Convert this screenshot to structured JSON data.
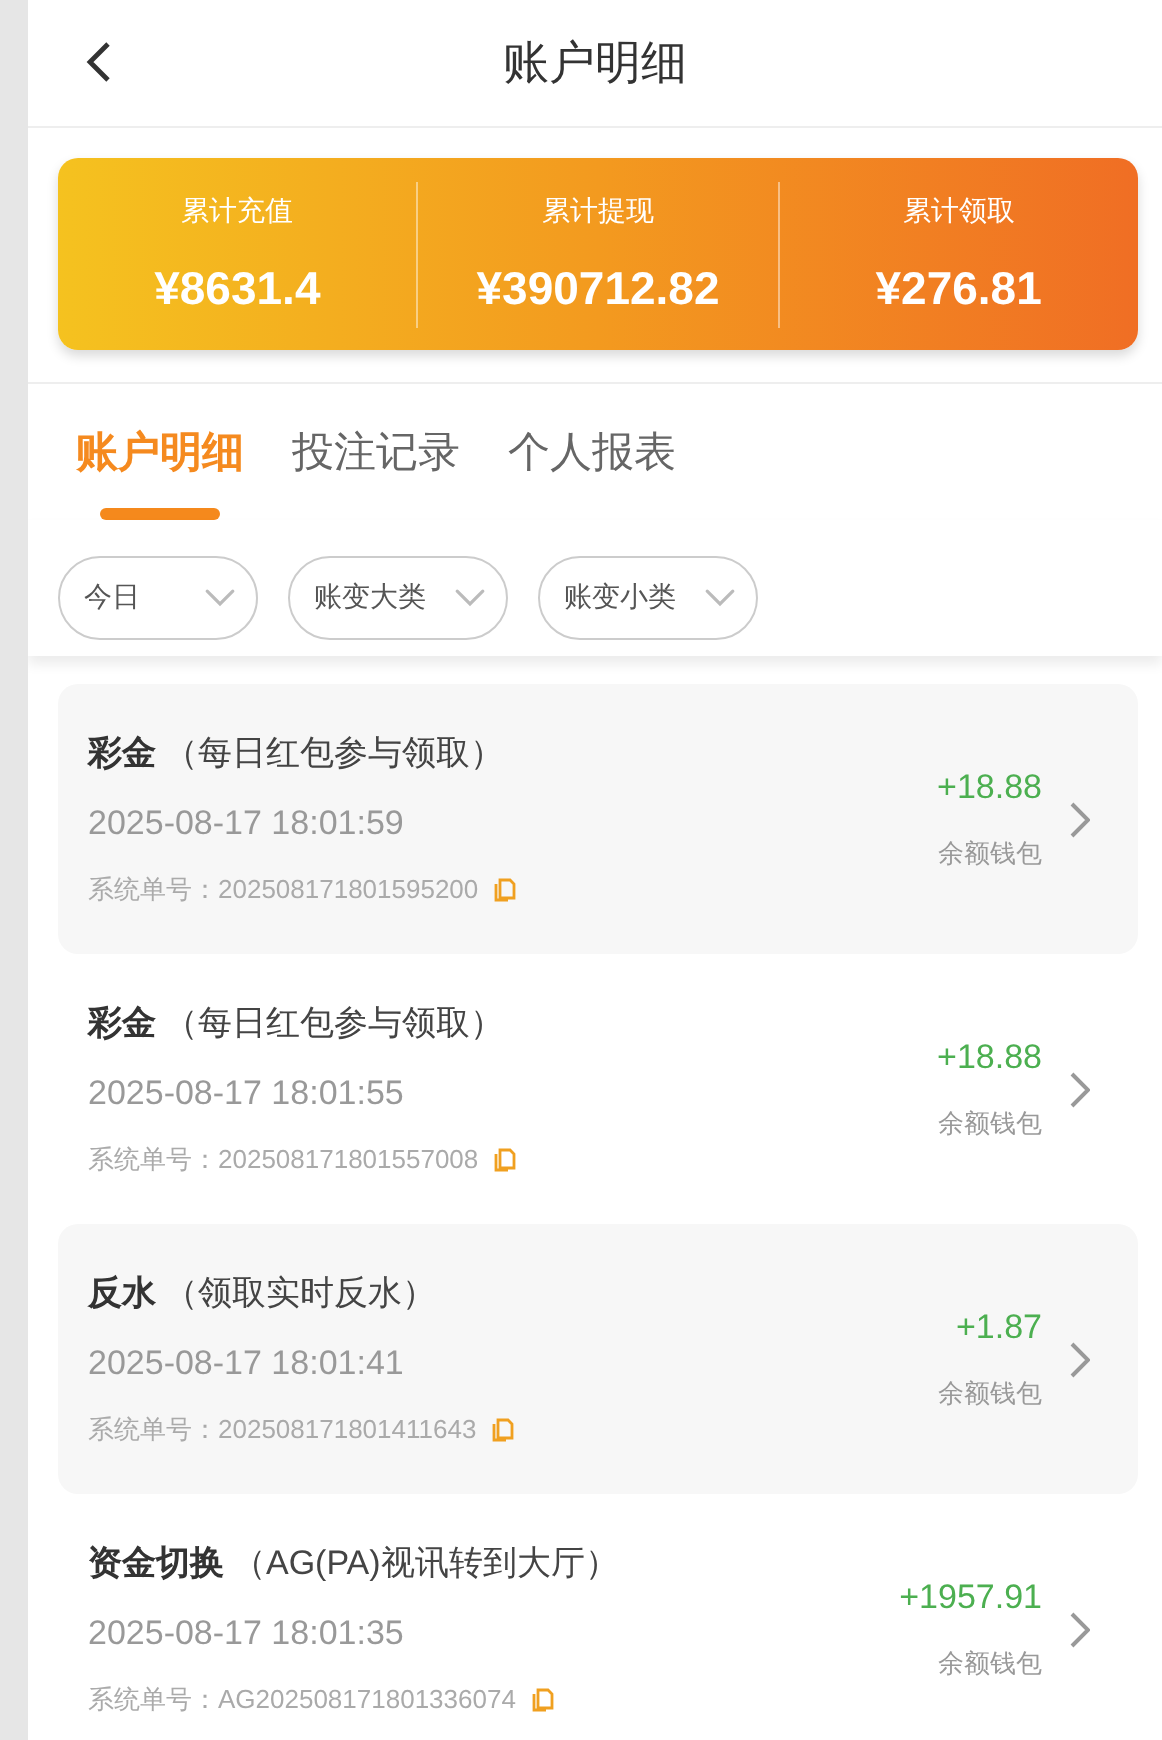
{
  "header": {
    "title": "账户明细"
  },
  "summary": [
    {
      "label": "累计充值",
      "value": "¥8631.4"
    },
    {
      "label": "累计提现",
      "value": "¥390712.82"
    },
    {
      "label": "累计领取",
      "value": "¥276.81"
    }
  ],
  "tabs": [
    {
      "label": "账户明细",
      "selected": true
    },
    {
      "label": "投注记录",
      "selected": false
    },
    {
      "label": "个人报表",
      "selected": false
    }
  ],
  "filters": [
    {
      "label": "今日"
    },
    {
      "label": "账变大类"
    },
    {
      "label": "账变小类"
    }
  ],
  "records": [
    {
      "type": "彩金",
      "note": "（每日红包参与领取）",
      "time": "2025-08-17 18:01:59",
      "order": "系统单号：202508171801595200",
      "amount": "+18.88",
      "wallet": "余额钱包"
    },
    {
      "type": "彩金",
      "note": "（每日红包参与领取）",
      "time": "2025-08-17 18:01:55",
      "order": "系统单号：202508171801557008",
      "amount": "+18.88",
      "wallet": "余额钱包"
    },
    {
      "type": "反水",
      "note": "（领取实时反水）",
      "time": "2025-08-17 18:01:41",
      "order": "系统单号：202508171801411643",
      "amount": "+1.87",
      "wallet": "余额钱包"
    },
    {
      "type": "资金切换",
      "note": "（AG(PA)视讯转到大厅）",
      "time": "2025-08-17 18:01:35",
      "order": "系统单号：AG202508171801336074",
      "amount": "+1957.91",
      "wallet": "余额钱包"
    }
  ]
}
